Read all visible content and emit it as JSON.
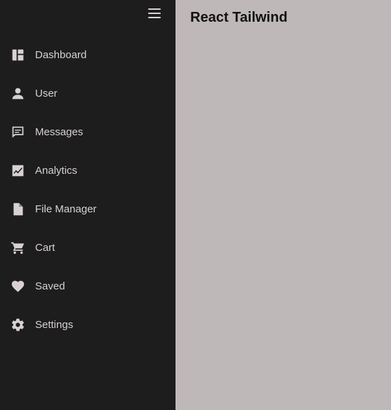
{
  "header": {
    "title": "React Tailwind"
  },
  "sidebar": {
    "items": [
      {
        "label": "Dashboard",
        "icon": "dashboard-icon"
      },
      {
        "label": "User",
        "icon": "user-icon"
      },
      {
        "label": "Messages",
        "icon": "messages-icon"
      },
      {
        "label": "Analytics",
        "icon": "analytics-icon"
      },
      {
        "label": "File Manager",
        "icon": "file-icon"
      },
      {
        "label": "Cart",
        "icon": "cart-icon"
      },
      {
        "label": "Saved",
        "icon": "heart-icon"
      },
      {
        "label": "Settings",
        "icon": "gear-icon"
      }
    ]
  },
  "colors": {
    "sidebar_bg": "#1d1d1d",
    "content_bg": "#beb8b8",
    "sidebar_text": "#d8d1d1",
    "title_text": "#111111"
  }
}
